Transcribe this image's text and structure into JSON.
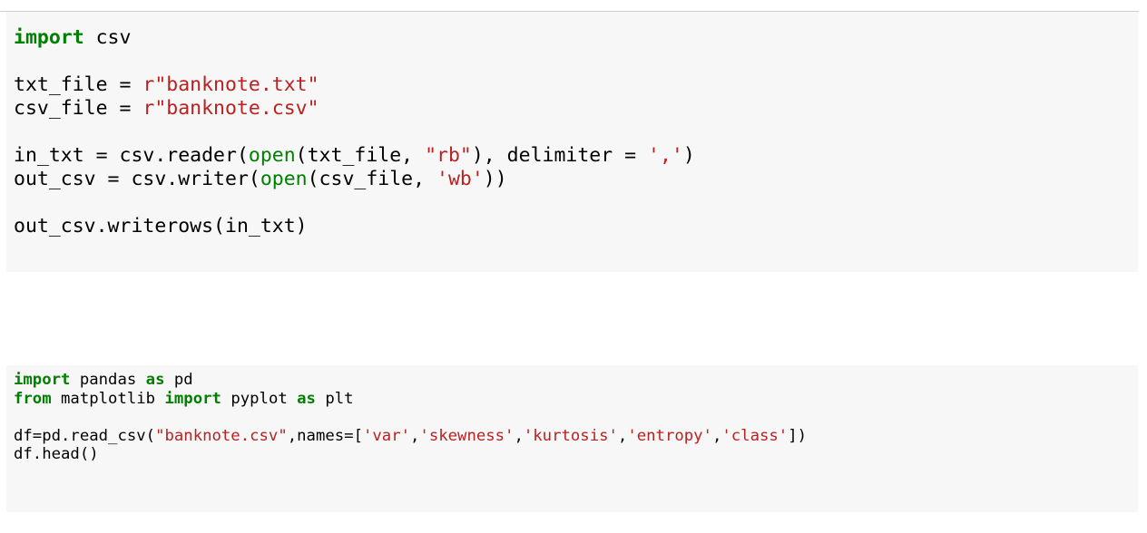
{
  "cells": [
    {
      "lines": [
        [
          {
            "t": "import",
            "c": "kw"
          },
          {
            "t": " csv",
            "c": "plain"
          }
        ],
        [],
        [
          {
            "t": "txt_file = ",
            "c": "plain"
          },
          {
            "t": "r\"banknote.txt\"",
            "c": "str"
          }
        ],
        [
          {
            "t": "csv_file = ",
            "c": "plain"
          },
          {
            "t": "r\"banknote.csv\"",
            "c": "str"
          }
        ],
        [],
        [
          {
            "t": "in_txt = csv.reader(",
            "c": "plain"
          },
          {
            "t": "open",
            "c": "builtin"
          },
          {
            "t": "(txt_file, ",
            "c": "plain"
          },
          {
            "t": "\"rb\"",
            "c": "str"
          },
          {
            "t": "), delimiter = ",
            "c": "plain"
          },
          {
            "t": "','",
            "c": "str"
          },
          {
            "t": ")",
            "c": "plain"
          }
        ],
        [
          {
            "t": "out_csv = csv.writer(",
            "c": "plain"
          },
          {
            "t": "open",
            "c": "builtin"
          },
          {
            "t": "(csv_file, ",
            "c": "plain"
          },
          {
            "t": "'wb'",
            "c": "str"
          },
          {
            "t": "))",
            "c": "plain"
          }
        ],
        [],
        [
          {
            "t": "out_csv.writerows(in_txt)",
            "c": "plain"
          }
        ]
      ]
    },
    {
      "lines": [
        [
          {
            "t": "import",
            "c": "kw"
          },
          {
            "t": " pandas ",
            "c": "plain"
          },
          {
            "t": "as",
            "c": "kw"
          },
          {
            "t": " pd",
            "c": "plain"
          }
        ],
        [
          {
            "t": "from",
            "c": "kw"
          },
          {
            "t": " matplotlib ",
            "c": "plain"
          },
          {
            "t": "import",
            "c": "kw"
          },
          {
            "t": " pyplot ",
            "c": "plain"
          },
          {
            "t": "as",
            "c": "kw"
          },
          {
            "t": " plt",
            "c": "plain"
          }
        ],
        [],
        [
          {
            "t": "df=pd.read_csv(",
            "c": "plain"
          },
          {
            "t": "\"banknote.csv\"",
            "c": "str"
          },
          {
            "t": ",names=[",
            "c": "plain"
          },
          {
            "t": "'var'",
            "c": "str"
          },
          {
            "t": ",",
            "c": "plain"
          },
          {
            "t": "'skewness'",
            "c": "str"
          },
          {
            "t": ",",
            "c": "plain"
          },
          {
            "t": "'kurtosis'",
            "c": "str"
          },
          {
            "t": ",",
            "c": "plain"
          },
          {
            "t": "'entropy'",
            "c": "str"
          },
          {
            "t": ",",
            "c": "plain"
          },
          {
            "t": "'class'",
            "c": "str"
          },
          {
            "t": "])",
            "c": "plain"
          }
        ],
        [
          {
            "t": "df.head()",
            "c": "plain"
          }
        ]
      ]
    }
  ]
}
